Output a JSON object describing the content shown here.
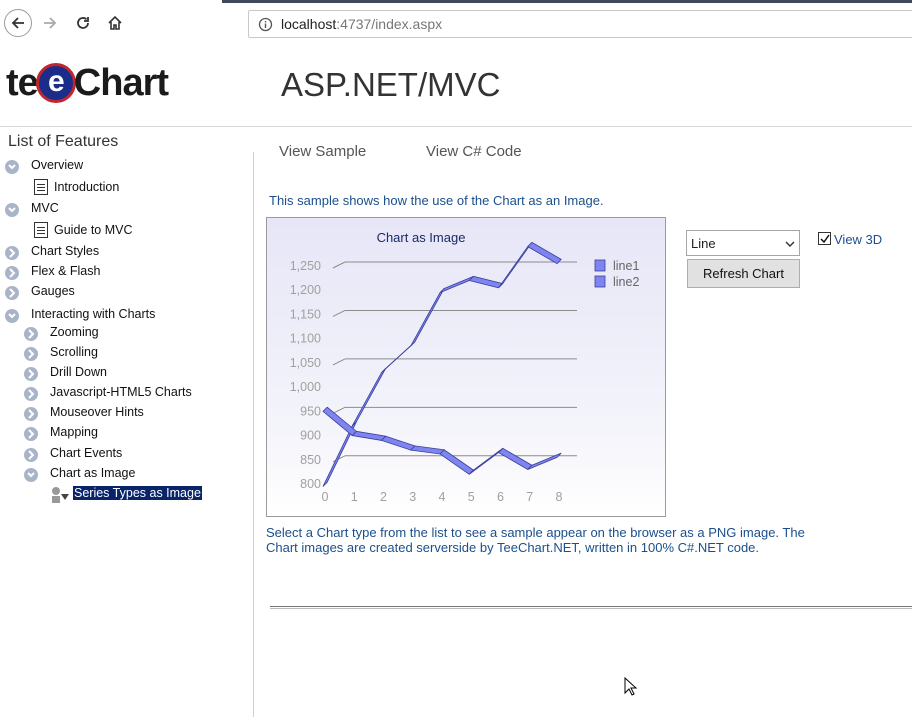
{
  "browser": {
    "url_host": "localhost",
    "url_rest": ":4737/index.aspx"
  },
  "header": {
    "logo_pre": "te",
    "logo_e": "e",
    "logo_post": "Chart",
    "title": "ASP.NET/MVC"
  },
  "sidebar": {
    "title": "List of Features",
    "items": [
      {
        "label": "Overview"
      },
      {
        "label": "Introduction"
      },
      {
        "label": "MVC"
      },
      {
        "label": "Guide to MVC"
      },
      {
        "label": "Chart Styles"
      },
      {
        "label": "Flex & Flash"
      },
      {
        "label": "Gauges"
      },
      {
        "label": "Interacting with Charts"
      },
      {
        "label": "Zooming"
      },
      {
        "label": "Scrolling"
      },
      {
        "label": "Drill Down"
      },
      {
        "label": "Javascript-HTML5 Charts"
      },
      {
        "label": "Mouseover Hints"
      },
      {
        "label": "Mapping"
      },
      {
        "label": "Chart Events"
      },
      {
        "label": "Chart as Image"
      },
      {
        "label": "Series Types as Image"
      }
    ]
  },
  "tabs": {
    "view_sample": "View Sample",
    "view_code": "View C# Code"
  },
  "content": {
    "description": "This sample shows how the use of the Chart as an Image.",
    "footer_text": "Select a Chart type from the list to see a sample appear on the browser as a PNG image. The Chart images are created serverside by TeeChart.NET, written in 100% C#.NET code."
  },
  "controls": {
    "select_value": "Line",
    "refresh_label": "Refresh Chart",
    "view3d_label": "View 3D",
    "view3d_checked": true
  },
  "chart_data": {
    "type": "line",
    "title": "Chart as Image",
    "three_d": true,
    "x": [
      0,
      1,
      2,
      3,
      4,
      5,
      6,
      7,
      8
    ],
    "x_ticks": [
      "0",
      "1",
      "2",
      "3",
      "4",
      "5",
      "6",
      "7",
      "8"
    ],
    "y_ticks": [
      "800",
      "850",
      "900",
      "950",
      "1,000",
      "1,050",
      "1,100",
      "1,150",
      "1,200",
      "1,250"
    ],
    "ylim": [
      800,
      1250
    ],
    "series": [
      {
        "name": "line1",
        "values": [
          795,
          920,
          1030,
          1085,
          1195,
          1220,
          1205,
          1290,
          1255
        ]
      },
      {
        "name": "line2",
        "values": [
          950,
          900,
          890,
          870,
          862,
          820,
          865,
          830,
          855
        ]
      }
    ],
    "series_color": "#7f85f0",
    "legend_position": "top-right",
    "grid": true
  }
}
